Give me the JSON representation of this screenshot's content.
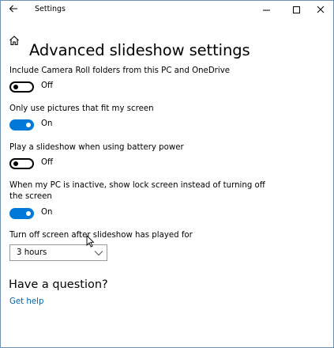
{
  "window": {
    "title": "Settings",
    "icons": [
      "back-arrow-icon",
      "minimize-icon",
      "maximize-icon",
      "close-icon"
    ]
  },
  "header": {
    "icon": "home-icon",
    "title": "Advanced slideshow settings"
  },
  "settings": [
    {
      "label": "Include Camera Roll folders from this PC and OneDrive",
      "state_label": "Off",
      "on": false
    },
    {
      "label": "Only use pictures that fit my screen",
      "state_label": "On",
      "on": true
    },
    {
      "label": "Play a slideshow when using battery power",
      "state_label": "Off",
      "on": false
    },
    {
      "label_line1": "When my PC is inactive, show lock screen instead of turning off",
      "label_line2": "the screen",
      "state_label": "On",
      "on": true
    }
  ],
  "screen_off": {
    "label": "Turn off screen after slideshow has played for",
    "selected": "3 hours"
  },
  "help": {
    "heading": "Have a question?",
    "link": "Get help"
  },
  "colors": {
    "accent": "#0078d7",
    "link": "#0063b1",
    "window_border": "#6f8fb8"
  }
}
